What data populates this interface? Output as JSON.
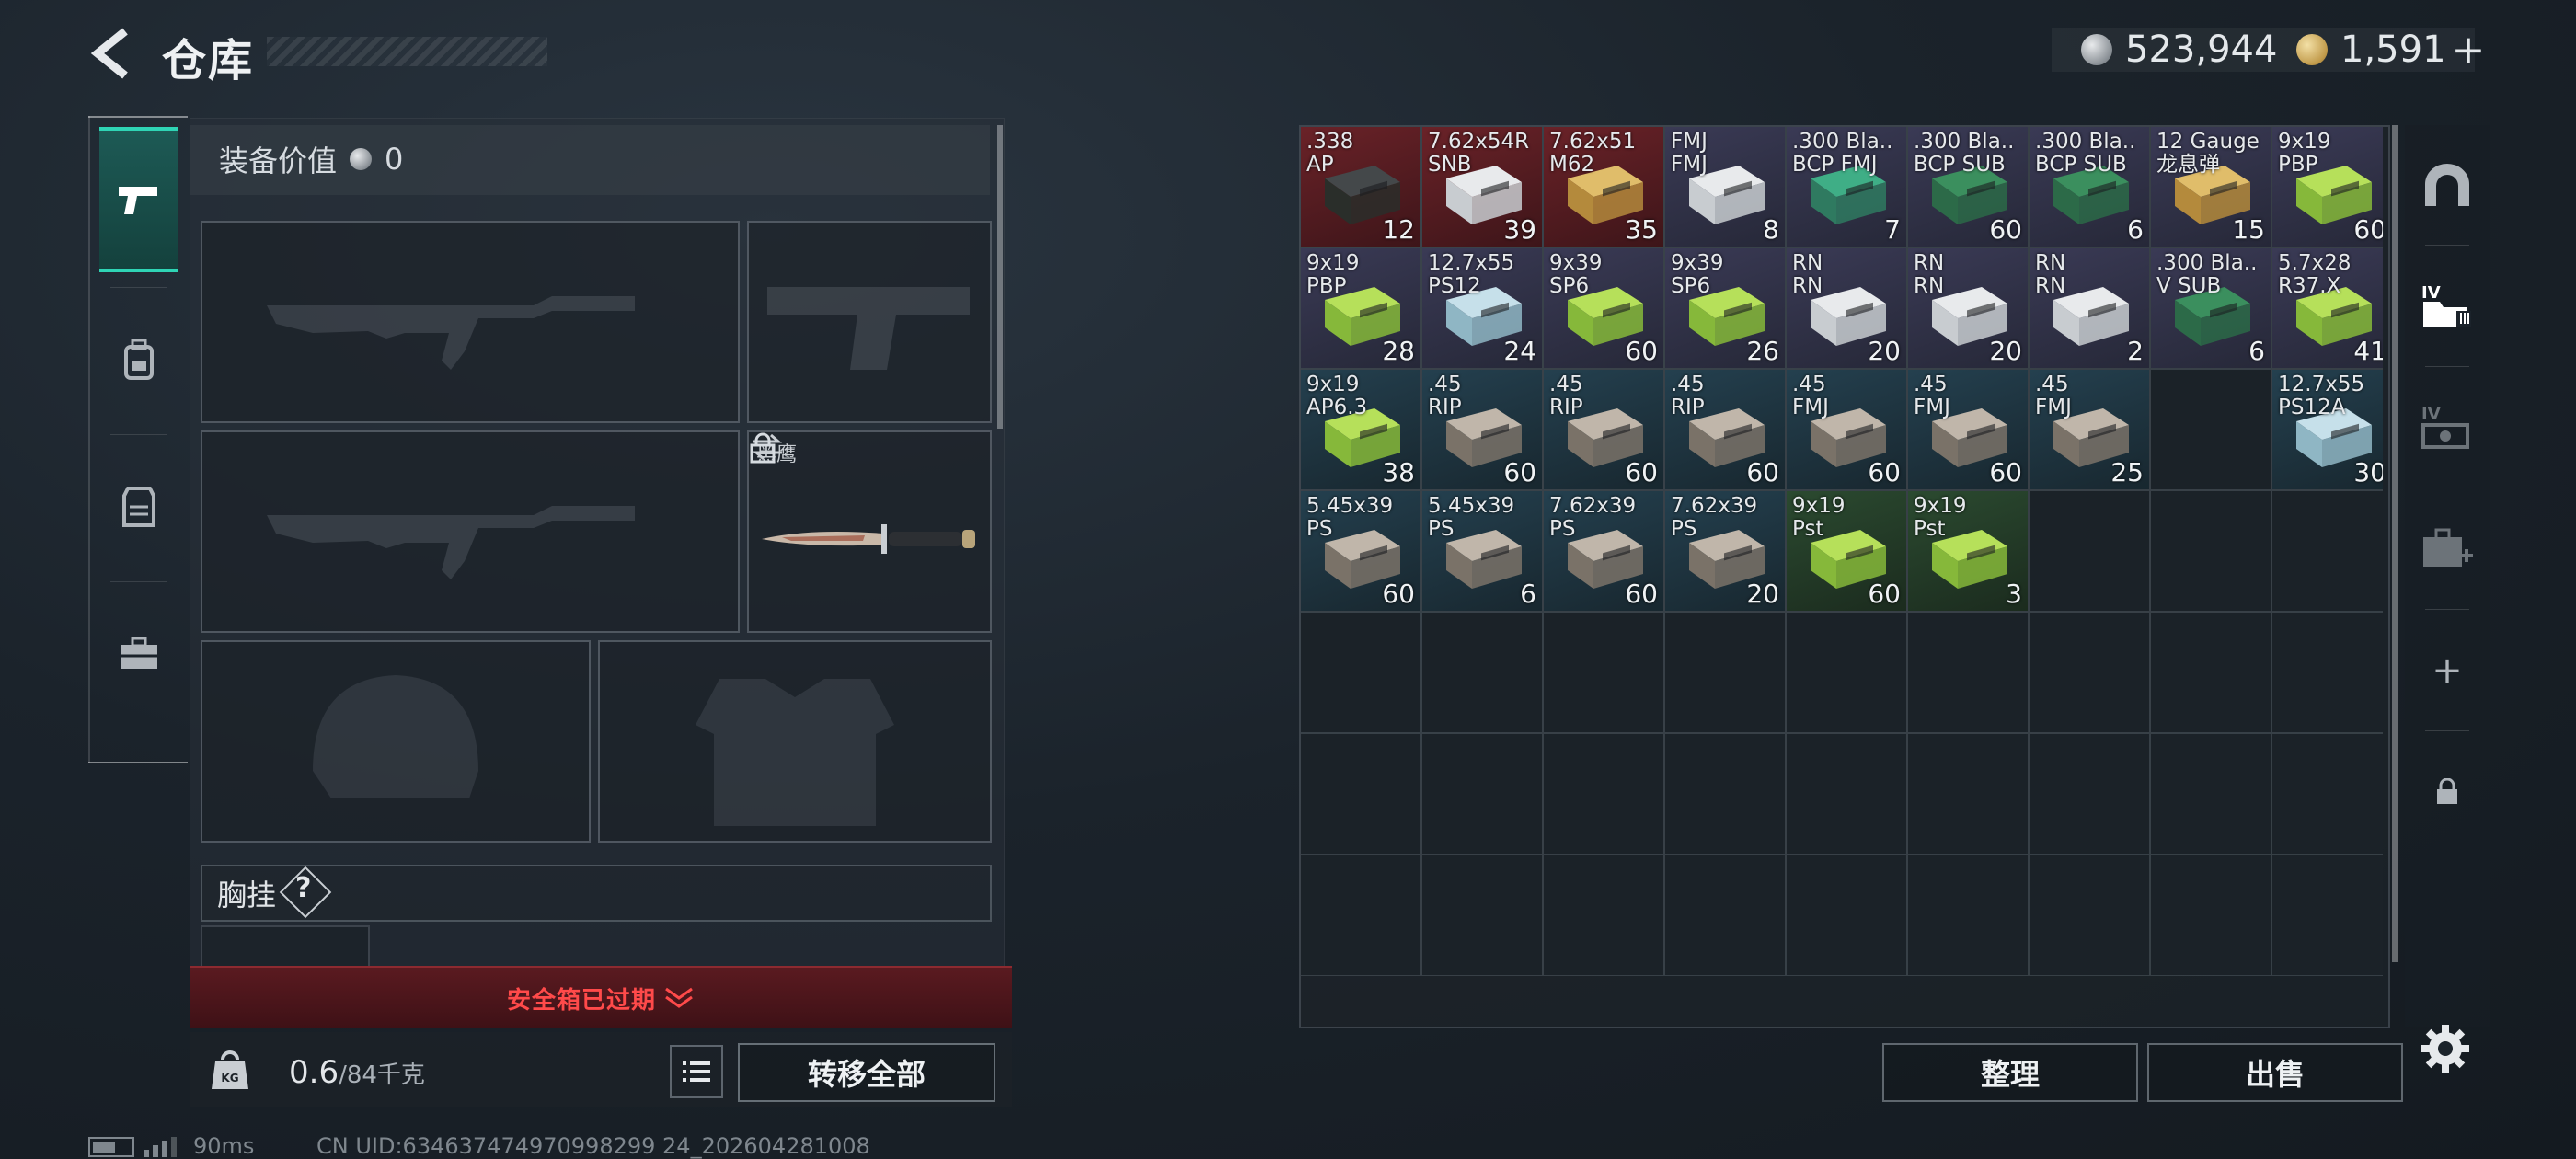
{
  "header": {
    "title": "仓库",
    "currency_silver": "523,944",
    "currency_gold": "1,591",
    "add_label": "+"
  },
  "equipment": {
    "value_label": "装备价值",
    "value": "0",
    "knife_name": "黑鹰",
    "chest_label": "胸挂",
    "help_label": "?",
    "safe_box_status": "安全箱已过期",
    "weight_current": "0.6",
    "weight_capacity": "/84千克",
    "transfer_all_label": "转移全部"
  },
  "storage": {
    "items": [
      {
        "name": ".338\nAP",
        "count": "12",
        "tint": "red",
        "box": "dark"
      },
      {
        "name": "7.62x54R\nSNB",
        "count": "39",
        "tint": "red",
        "box": "white"
      },
      {
        "name": "7.62x51\nM62",
        "count": "35",
        "tint": "red",
        "box": "gold"
      },
      {
        "name": "FMJ\nFMJ",
        "count": "8",
        "tint": "purple",
        "box": "white"
      },
      {
        "name": ".300 Bla..\nBCP FMJ",
        "count": "7",
        "tint": "purple",
        "box": "teal"
      },
      {
        "name": ".300 Bla..\nBCP SUB",
        "count": "60",
        "tint": "purple",
        "box": "mag"
      },
      {
        "name": ".300 Bla..\nBCP SUB",
        "count": "6",
        "tint": "purple",
        "box": "mag"
      },
      {
        "name": "12 Gauge\n龙息弹",
        "count": "15",
        "tint": "purple",
        "box": "gold"
      },
      {
        "name": "9x19\nPBP",
        "count": "60",
        "tint": "purple",
        "box": "green"
      },
      {
        "name": "9x19\nPBP",
        "count": "28",
        "tint": "purple",
        "box": "green"
      },
      {
        "name": "12.7x55\nPS12",
        "count": "24",
        "tint": "purple",
        "box": "blue"
      },
      {
        "name": "9x39\nSP6",
        "count": "60",
        "tint": "purple",
        "box": "green"
      },
      {
        "name": "9x39\nSP6",
        "count": "26",
        "tint": "purple",
        "box": "green"
      },
      {
        "name": "RN\nRN",
        "count": "20",
        "tint": "purple",
        "box": "white"
      },
      {
        "name": "RN\nRN",
        "count": "20",
        "tint": "purple",
        "box": "white"
      },
      {
        "name": "RN\nRN",
        "count": "2",
        "tint": "purple",
        "box": "white"
      },
      {
        "name": ".300 Bla..\nV SUB",
        "count": "6",
        "tint": "purple",
        "box": "mag"
      },
      {
        "name": "5.7x28\nR37.X",
        "count": "41",
        "tint": "purple",
        "box": "green"
      },
      {
        "name": "9x19\nAP6.3",
        "count": "38",
        "tint": "blue",
        "box": "green"
      },
      {
        "name": ".45\nRIP",
        "count": "60",
        "tint": "blue",
        "box": "grey"
      },
      {
        "name": ".45\nRIP",
        "count": "60",
        "tint": "blue",
        "box": "grey"
      },
      {
        "name": ".45\nRIP",
        "count": "60",
        "tint": "blue",
        "box": "grey"
      },
      {
        "name": ".45\nFMJ",
        "count": "60",
        "tint": "blue",
        "box": "grey"
      },
      {
        "name": ".45\nFMJ",
        "count": "60",
        "tint": "blue",
        "box": "grey"
      },
      {
        "name": ".45\nFMJ",
        "count": "25",
        "tint": "blue",
        "box": "grey"
      },
      {
        "name": "",
        "count": "",
        "tint": "empty",
        "box": ""
      },
      {
        "name": "12.7x55\nPS12A",
        "count": "30",
        "tint": "blue",
        "box": "blue"
      },
      {
        "name": "5.45x39\nPS",
        "count": "60",
        "tint": "blue",
        "box": "grey"
      },
      {
        "name": "5.45x39\nPS",
        "count": "6",
        "tint": "blue",
        "box": "grey"
      },
      {
        "name": "7.62x39\nPS",
        "count": "60",
        "tint": "blue",
        "box": "grey"
      },
      {
        "name": "7.62x39\nPS",
        "count": "20",
        "tint": "blue",
        "box": "grey"
      },
      {
        "name": "9x19\nPst",
        "count": "60",
        "tint": "green",
        "box": "green"
      },
      {
        "name": "9x19\nPst",
        "count": "3",
        "tint": "green",
        "box": "green"
      }
    ],
    "empty_cells": 30,
    "sort_label": "整理",
    "sell_label": "出售"
  },
  "side_nav": {
    "add_label": "+"
  },
  "footer": {
    "ping": "90ms",
    "uid": "CN UID:634637474970998299 24_202604281008"
  },
  "colors": {
    "accent": "#2fd4b5",
    "danger": "#ff4a4a",
    "tint_red": "#5a2024",
    "tint_purple": "#33344a",
    "tint_blue": "#1f3644",
    "tint_green": "#24382a"
  }
}
